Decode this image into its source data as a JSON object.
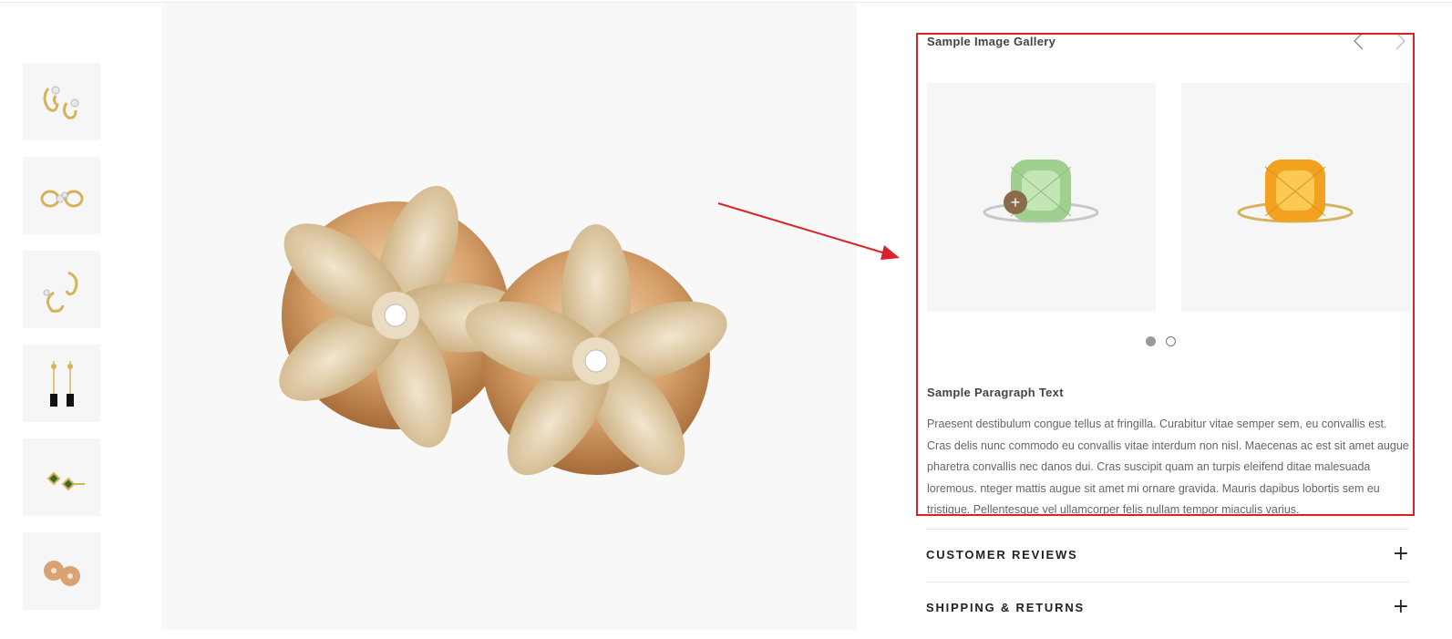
{
  "thumbnails": [
    {
      "name": "Diamond swirl earrings"
    },
    {
      "name": "Diamond hoop earrings"
    },
    {
      "name": "Twisted hoop earrings"
    },
    {
      "name": "Tassel drop earrings"
    },
    {
      "name": "Emerald bar earrings"
    },
    {
      "name": "Flower stud earrings"
    }
  ],
  "gallery": {
    "title": "Sample Image Gallery",
    "prev_icon": "chevron-left-icon",
    "next_icon": "chevron-right-icon",
    "plus_label": "+",
    "dots": [
      {
        "active": true
      },
      {
        "active": false
      }
    ]
  },
  "paragraph": {
    "title": "Sample Paragraph Text",
    "text": "Praesent destibulum congue tellus at fringilla. Curabitur vitae semper sem, eu convallis est. Cras delis nunc commodo eu convallis vitae interdum non nisl. Maecenas ac est sit amet augue pharetra convallis nec danos dui. Cras suscipit quam an turpis eleifend ditae malesuada loremous. nteger mattis augue sit amet mi ornare gravida. Mauris dapibus lobortis sem eu tristique. Pellentesque vel ullamcorper felis nullam tempor miaculis varius."
  },
  "accordions": [
    {
      "label": "CUSTOMER REVIEWS",
      "icon": "+"
    },
    {
      "label": "SHIPPING & RETURNS",
      "icon": "+"
    }
  ],
  "colors": {
    "highlight": "#d9232a",
    "accent_brown": "#8a6b4a"
  }
}
